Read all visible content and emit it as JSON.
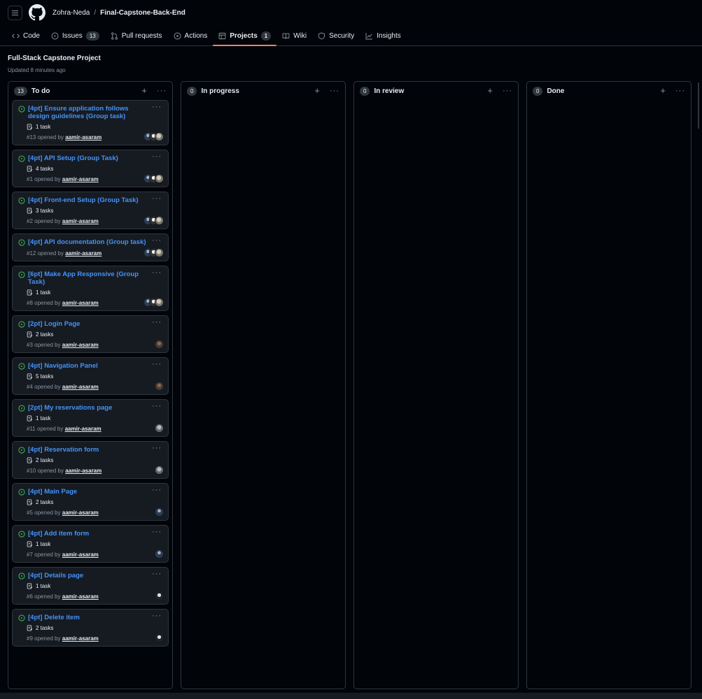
{
  "header": {
    "owner": "Zohra-Neda",
    "separator": "/",
    "repo": "Final-Capstone-Back-End"
  },
  "nav": [
    {
      "label": "Code",
      "icon": "code-icon"
    },
    {
      "label": "Issues",
      "icon": "issue-icon",
      "count": "13"
    },
    {
      "label": "Pull requests",
      "icon": "pull-request-icon"
    },
    {
      "label": "Actions",
      "icon": "play-icon"
    },
    {
      "label": "Projects",
      "icon": "table-icon",
      "count": "1",
      "active": true
    },
    {
      "label": "Wiki",
      "icon": "book-icon"
    },
    {
      "label": "Security",
      "icon": "shield-icon"
    },
    {
      "label": "Insights",
      "icon": "graph-icon"
    }
  ],
  "project": {
    "title": "Full-Stack Capstone Project",
    "updated": "Updated 8 minutes ago"
  },
  "columns": [
    {
      "name": "To do",
      "count": "13"
    },
    {
      "name": "In progress",
      "count": "0"
    },
    {
      "name": "In review",
      "count": "0"
    },
    {
      "name": "Done",
      "count": "0"
    }
  ],
  "cards": [
    {
      "title": "[4pt] Ensure application follows design guidelines (Group task)",
      "tasks": "1 task",
      "number": "#13",
      "opened": "opened by",
      "author": "aamir-asaram",
      "avatars": [
        "av1",
        "av2",
        "av3"
      ]
    },
    {
      "title": "[4pt] API Setup (Group Task)",
      "tasks": "4 tasks",
      "number": "#1",
      "opened": "opened by",
      "author": "aamir-asaram",
      "avatars": [
        "av1",
        "av2",
        "av3"
      ]
    },
    {
      "title": "[4pt] Front-end Setup (Group Task)",
      "tasks": "3 tasks",
      "number": "#2",
      "opened": "opened by",
      "author": "aamir-asaram",
      "avatars": [
        "av1",
        "av2",
        "av3"
      ]
    },
    {
      "title": "[4pt] API documentation (Group task)",
      "tasks": "",
      "number": "#12",
      "opened": "opened by",
      "author": "aamir-asaram",
      "avatars": [
        "av1",
        "av2",
        "av3"
      ]
    },
    {
      "title": "[6pt] Make App Responsive (Group Task)",
      "tasks": "1 task",
      "number": "#8",
      "opened": "opened by",
      "author": "aamir-asaram",
      "avatars": [
        "av1",
        "av2",
        "av3"
      ]
    },
    {
      "title": "[2pt] Login Page",
      "tasks": "2 tasks",
      "number": "#3",
      "opened": "opened by",
      "author": "aamir-asaram",
      "avatars": [
        "av4"
      ]
    },
    {
      "title": "[4pt] Navigation Panel",
      "tasks": "5 tasks",
      "number": "#4",
      "opened": "opened by",
      "author": "aamir-asaram",
      "avatars": [
        "av4"
      ]
    },
    {
      "title": "[2pt] My reservations page",
      "tasks": "1 task",
      "number": "#11",
      "opened": "opened by",
      "author": "aamir-asaram",
      "avatars": [
        "av5"
      ]
    },
    {
      "title": "[4pt] Reservation form",
      "tasks": "2 tasks",
      "number": "#10",
      "opened": "opened by",
      "author": "aamir-asaram",
      "avatars": [
        "av5"
      ]
    },
    {
      "title": "[4pt] Main Page",
      "tasks": "2 tasks",
      "number": "#5",
      "opened": "opened by",
      "author": "aamir-asaram",
      "avatars": [
        "av1"
      ]
    },
    {
      "title": "[4pt] Add item form",
      "tasks": "1 task",
      "number": "#7",
      "opened": "opened by",
      "author": "aamir-asaram",
      "avatars": [
        "av1"
      ]
    },
    {
      "title": "[4pt] Details page",
      "tasks": "1 task",
      "number": "#6",
      "opened": "opened by",
      "author": "aamir-asaram",
      "avatars": [
        "av6"
      ]
    },
    {
      "title": "[4pt] Delete item",
      "tasks": "2 tasks",
      "number": "#9",
      "opened": "opened by",
      "author": "aamir-asaram",
      "avatars": [
        "av6"
      ]
    }
  ],
  "colors": {
    "background": "#010409",
    "card": "#161b22",
    "border": "#30363d",
    "link": "#4493f8",
    "open": "#3fb950",
    "active_underline": "#f78166"
  }
}
